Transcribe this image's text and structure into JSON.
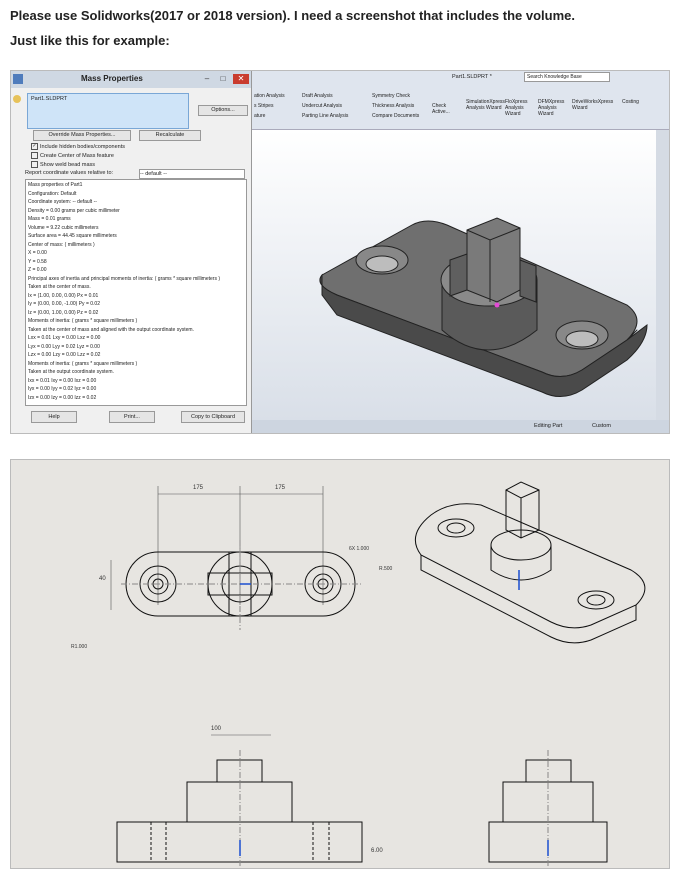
{
  "question": {
    "line1": "Please use Solidworks(2017 or 2018 version). I need a screenshot that includes the volume.",
    "line2": "Just like this for example:"
  },
  "mass_properties": {
    "title": "Mass Properties",
    "selected_part": "Part1.SLDPRT",
    "options_label": "Options...",
    "override_label": "Override Mass Properties...",
    "recalculate_label": "Recalculate",
    "include_hidden": "Include hidden bodies/components",
    "create_center": "Create Center of Mass feature",
    "show_weld": "Show weld bead mass",
    "report_label": "Report coordinate values relative to:",
    "report_value": "-- default --",
    "results": [
      "Mass properties of Part1",
      "Configuration: Default",
      "Coordinate system: -- default --",
      "Density = 0.00 grams per cubic millimeter",
      "Mass = 0.01 grams",
      "Volume = 9.22 cubic millimeters",
      "Surface area = 44.45 square millimeters",
      "Center of mass: ( millimeters )",
      "X = 0.00",
      "Y = 0.58",
      "Z = 0.00",
      "Principal axes of inertia and principal moments of inertia: ( grams * square millimeters )",
      "Taken at the center of mass.",
      "Ix = (1.00, 0.00, 0.00)     Px = 0.01",
      "Iy = (0.00, 0.00, -1.00)    Py = 0.02",
      "Iz = (0.00, 1.00, 0.00)     Pz = 0.02",
      "Moments of inertia: ( grams * square millimeters )",
      "Taken at the center of mass and aligned with the output coordinate system.",
      "Lxx = 0.01     Lxy = 0.00     Lxz = 0.00",
      "Lyx = 0.00     Lyy = 0.02     Lyz = 0.00",
      "Lzx = 0.00     Lzy = 0.00     Lzz = 0.02",
      "Moments of inertia: ( grams * square millimeters )",
      "Taken at the output coordinate system.",
      "Ixx = 0.01     Ixy = 0.00     Ixz = 0.00",
      "Iyx = 0.00     Iyy = 0.02     Iyz = 0.00",
      "Izx = 0.00     Izy = 0.00     Izz = 0.02"
    ],
    "help_label": "Help",
    "print_label": "Print...",
    "copy_label": "Copy to Clipboard"
  },
  "solidworks": {
    "title": "Part1.SLDPRT *",
    "search_placeholder": "Search Knowledge Base",
    "tools": {
      "draft_analysis": "Draft Analysis",
      "undercut_analysis": "Undercut Analysis",
      "parting_line": "Parting Line Analysis",
      "symmetry_check": "Symmetry Check",
      "thickness_analysis": "Thickness Analysis",
      "compare_documents": "Compare Documents",
      "check_active": "Check Active...",
      "simulation": "SimulationXpress Analysis Wizard",
      "floxpress": "FloXpress Analysis Wizard",
      "dfmxpress": "DFMXpress Analysis Wizard",
      "driveworks": "DriveWorksXpress Wizard",
      "costing": "Costing",
      "stripes": "s Stripes",
      "ation_analysis": "ation Analysis",
      "ature": "ature"
    },
    "status_editing": "Editing Part",
    "status_custom": "Custom"
  },
  "drawing": {
    "dim1": "175",
    "dim2": "175",
    "dim3": "40",
    "dim4": "100",
    "dim5": "6.00",
    "label_a": "6X 1.000",
    "label_b": "R.500",
    "label_c": "R1.000"
  }
}
